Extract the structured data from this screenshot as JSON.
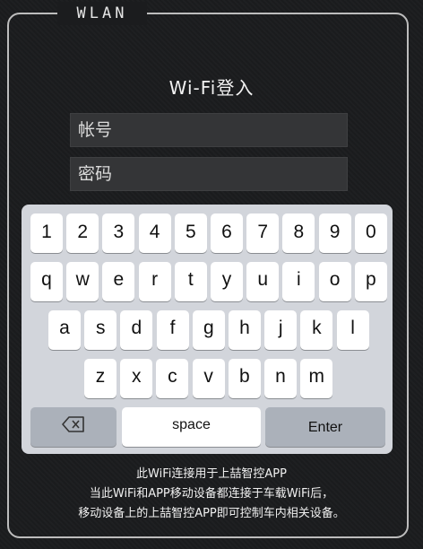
{
  "frame": {
    "title": "WLAN"
  },
  "login": {
    "title": "Wi-Fi登入",
    "account_placeholder": "帐号",
    "password_placeholder": "密码"
  },
  "keyboard": {
    "rows": [
      [
        "1",
        "2",
        "3",
        "4",
        "5",
        "6",
        "7",
        "8",
        "9",
        "0"
      ],
      [
        "q",
        "w",
        "e",
        "r",
        "t",
        "y",
        "u",
        "i",
        "o",
        "p"
      ],
      [
        "a",
        "s",
        "d",
        "f",
        "g",
        "h",
        "j",
        "k",
        "l"
      ],
      [
        "z",
        "x",
        "c",
        "v",
        "b",
        "n",
        "m"
      ]
    ],
    "space_label": "space",
    "enter_label": "Enter",
    "backspace_icon": "backspace-icon"
  },
  "footer": {
    "lines": [
      "此WiFi连接用于上喆智控APP",
      "当此WiFi和APP移动设备都连接于车载WiFi后，",
      "移动设备上的上喆智控APP即可控制车内相关设备。"
    ]
  }
}
